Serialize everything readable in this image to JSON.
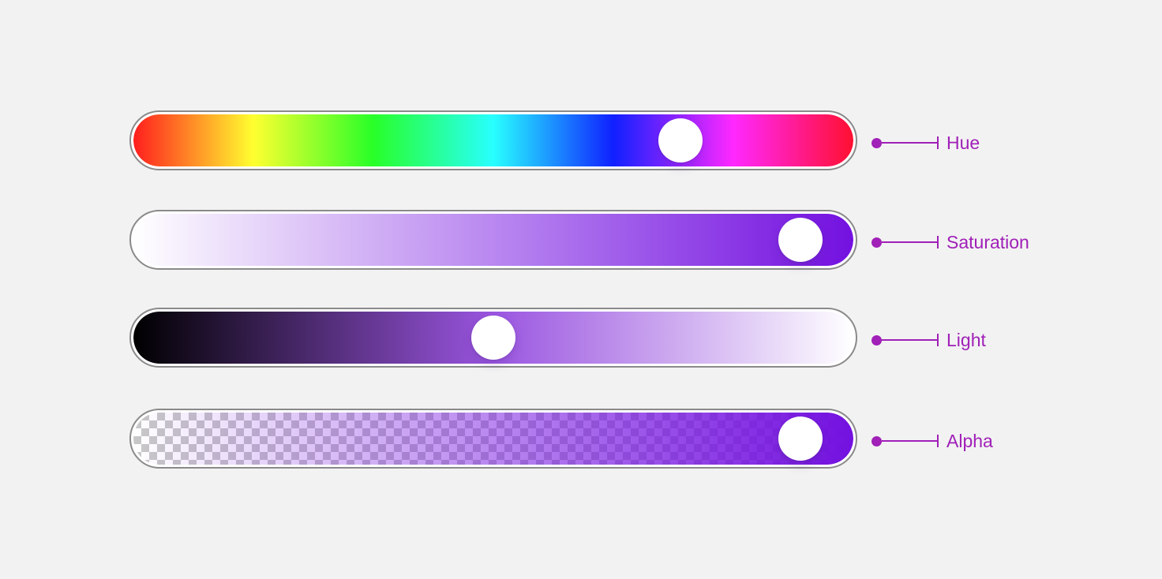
{
  "colors": {
    "background": "#f2f2f2",
    "accent": "#a020b8",
    "purple": "#7310e0",
    "frame_border": "#8a8a8a"
  },
  "sliders": [
    {
      "id": "hue",
      "label": "Hue",
      "value_fraction": 0.78,
      "gradient": [
        "#ff1e1e",
        "#ffff30",
        "#28ff28",
        "#28ffff",
        "#1020ff",
        "#ff28ff",
        "#ff1030"
      ]
    },
    {
      "id": "saturation",
      "label": "Saturation",
      "value_fraction": 0.96,
      "gradient": [
        "#ffffff",
        "#7310e0"
      ]
    },
    {
      "id": "light",
      "label": "Light",
      "value_fraction": 0.5,
      "gradient": [
        "#000000",
        "#9a55e0",
        "#ffffff"
      ]
    },
    {
      "id": "alpha",
      "label": "Alpha",
      "value_fraction": 0.96,
      "gradient": [
        "rgba(115,16,224,0)",
        "rgba(115,16,224,1)"
      ],
      "checkerboard": true
    }
  ]
}
